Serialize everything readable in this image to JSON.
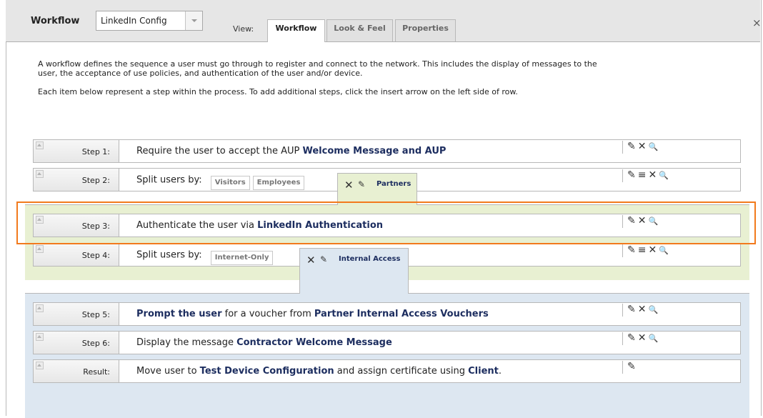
{
  "header": {
    "title": "Workflow",
    "config_select": "LinkedIn Config",
    "view_label": "View:",
    "tabs": [
      {
        "label": "Workflow",
        "active": true
      },
      {
        "label": "Look & Feel",
        "active": false
      },
      {
        "label": "Properties",
        "active": false
      }
    ],
    "close": "×"
  },
  "intro": {
    "para1": "A workflow defines the sequence a user must go through to register and connect to the network. This includes the display of messages to the user, the acceptance of use policies, and authentication of the user and/or device.",
    "para2": "Each item below represent a step within the process. To add additional steps, click the insert arrow on the left side of row."
  },
  "icons": {
    "edit": "✎",
    "reorder": "≡",
    "delete": "✕",
    "preview": "🔍"
  },
  "colors": {
    "highlight": "#f27a1d",
    "partners_group": "#e8f0d2",
    "internal_group": "#dde7f1",
    "bold_text": "#1c2d5f"
  },
  "steps": [
    {
      "label": "Step 1:",
      "text": "Require the user to accept the AUP ",
      "bold": "Welcome Message and AUP"
    },
    {
      "label": "Step 2:",
      "text": "Split users by:",
      "chips": [
        "Visitors",
        "Employees"
      ],
      "active_chip": "Partners"
    },
    {
      "label": "Step 3:",
      "text": "Authenticate the user via ",
      "bold": "LinkedIn Authentication"
    },
    {
      "label": "Step 4:",
      "text": "Split users by:",
      "chips": [
        "Internet-Only"
      ],
      "active_chip": "Internal Access"
    },
    {
      "label": "Step 5:",
      "bold_prefix": "Prompt the user",
      "text": " for a voucher from ",
      "bold": "Partner Internal Access Vouchers"
    },
    {
      "label": "Step 6:",
      "text": "Display the message ",
      "bold": "Contractor Welcome Message"
    },
    {
      "label": "Result:",
      "text": "Move user to ",
      "bold": "Test Device Configuration",
      "text2": " and assign certificate using ",
      "bold2": "Client",
      "text3": "."
    }
  ]
}
